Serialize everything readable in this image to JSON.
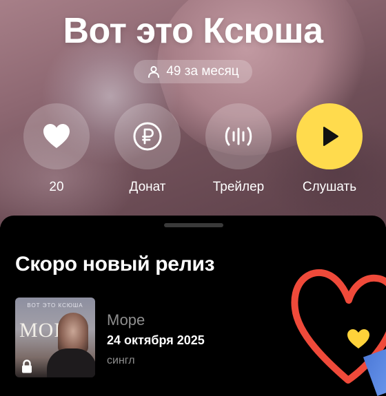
{
  "artist": {
    "title": "Вот это Ксюша",
    "listeners": "49 за месяц"
  },
  "actions": [
    {
      "label": "20",
      "icon": "heart-icon"
    },
    {
      "label": "Донат",
      "icon": "ruble-icon"
    },
    {
      "label": "Трейлер",
      "icon": "waveform-icon"
    },
    {
      "label": "Слушать",
      "icon": "play-icon"
    }
  ],
  "upcoming": {
    "section_title": "Скоро новый релиз",
    "release": {
      "name": "Море",
      "date": "24 октября 2025",
      "type": "сингл",
      "cover_artist": "ВОТ ЭТО КСЮША",
      "cover_word": "MOPE",
      "locked": true
    }
  },
  "colors": {
    "accent": "#ffdb4d",
    "heart_decor": "#ef4a3a",
    "sheet_bg": "#000000",
    "secondary_text": "#8e8e8e"
  }
}
